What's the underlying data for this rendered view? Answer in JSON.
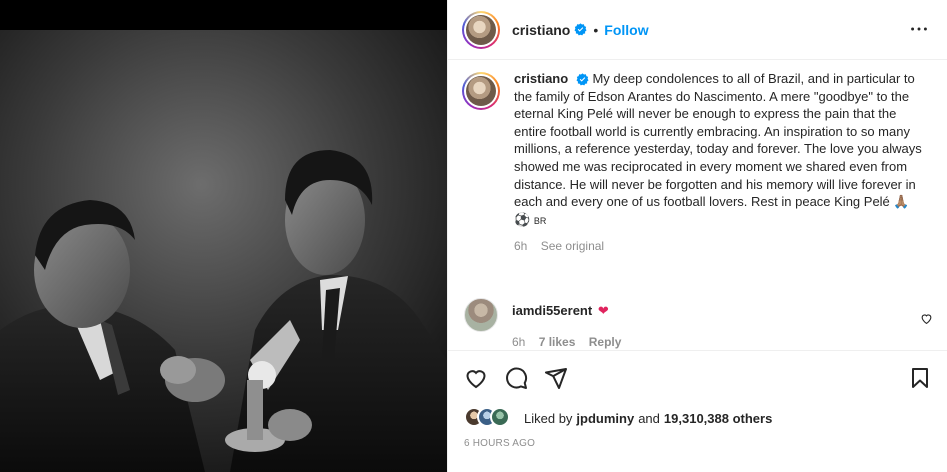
{
  "header": {
    "username": "cristiano",
    "follow_label": "Follow",
    "separator": "•"
  },
  "caption": {
    "username": "cristiano",
    "text": "My deep condolences to all of Brazil, and in particular to the family of Edson Arantes do Nascimento. A mere \"goodbye\" to the eternal King Pelé will never be enough to express the pain that the entire football world is currently embracing. An inspiration to so many millions, a reference yesterday, today and forever. The love you always showed me was reciprocated in every moment we shared even from distance. He will never be forgotten and his memory will live forever in each and every one of us football lovers. Rest in peace King Pelé",
    "emojis": "🙏🏽⚽",
    "flag_text": "BR",
    "age": "6h",
    "see_original": "See original"
  },
  "comment": {
    "username": "iamdi55erent",
    "emoji": "❤",
    "age": "6h",
    "likes": "7 likes",
    "reply": "Reply"
  },
  "likes": {
    "prefix": "Liked by",
    "user": "jpduminy",
    "and": "and",
    "others": "19,310,388 others"
  },
  "timestamp": "6 HOURS AGO",
  "colors": {
    "accent": "#0095f6",
    "text": "#262626",
    "muted": "#8e8e8e",
    "border": "#efefef"
  },
  "icons": [
    "verified-badge-icon",
    "more-options-icon",
    "heart-icon",
    "comment-icon",
    "share-icon",
    "bookmark-icon"
  ]
}
